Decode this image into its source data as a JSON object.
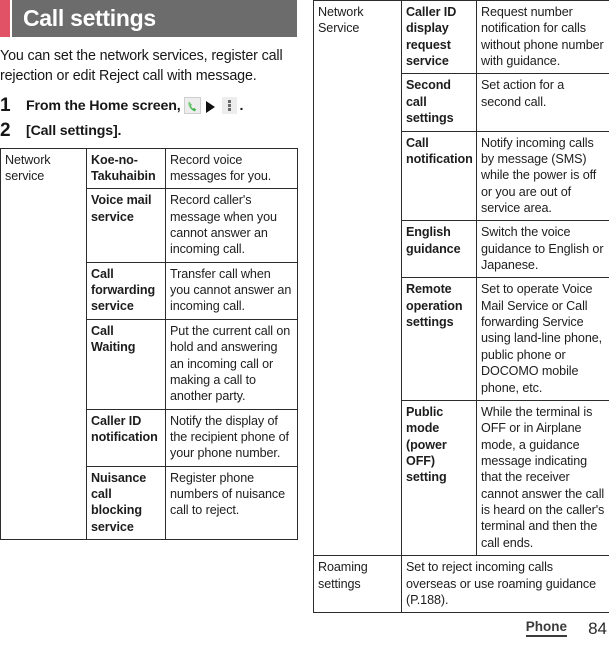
{
  "header": {
    "title": "Call settings",
    "accent_color": "#e15267",
    "bg_color": "#6d6c6c"
  },
  "intro": "You can set the network services, register call rejection or edit Reject call with message.",
  "steps": [
    {
      "number": "1",
      "text_before": "From the Home screen,",
      "icons": [
        "phone-icon",
        "arrow-right-icon",
        "overflow-menu-icon"
      ],
      "text_after": "."
    },
    {
      "number": "2",
      "text_before": "[Call settings].",
      "icons": [],
      "text_after": ""
    }
  ],
  "left_table": {
    "group_label": "Network service",
    "rows": [
      {
        "name": "Koe-no-Takuhaibin",
        "desc": "Record voice messages for you."
      },
      {
        "name": "Voice mail service",
        "desc": "Record caller's message when you cannot answer an incoming call."
      },
      {
        "name": "Call forwarding service",
        "desc": "Transfer call when you cannot answer an incoming call."
      },
      {
        "name": "Call Waiting",
        "desc": "Put the current call on hold and answering an incoming call or making a call to another party."
      },
      {
        "name": "Caller ID notification",
        "desc": "Notify the display of the recipient phone of your phone number."
      },
      {
        "name": "Nuisance call blocking service",
        "desc": "Register phone numbers of nuisance call to reject."
      }
    ]
  },
  "right_table": {
    "group_label": "Network Service",
    "rows": [
      {
        "name": "Caller ID display request service",
        "desc": "Request number notification for calls without phone number with guidance."
      },
      {
        "name": "Second call settings",
        "desc": "Set action for a second call."
      },
      {
        "name": "Call notification",
        "desc": "Notify incoming calls by message (SMS) while the power is off or you are out of service area."
      },
      {
        "name": "English guidance",
        "desc": "Switch the voice guidance to English or Japanese."
      },
      {
        "name": "Remote operation settings",
        "desc": "Set to operate Voice Mail Service or Call forwarding Service using land-line phone, public phone or DOCOMO mobile phone, etc."
      },
      {
        "name": "Public mode (power OFF) setting",
        "desc": "While the terminal is OFF or in Airplane mode, a guidance message indicating that the receiver cannot answer the call is heard on the caller's terminal and then the call ends."
      }
    ],
    "final_row": {
      "name": "Roaming settings",
      "desc": "Set to reject incoming calls overseas or use roaming guidance (P.188)."
    }
  },
  "footer": {
    "chapter": "Phone",
    "page": "84"
  }
}
